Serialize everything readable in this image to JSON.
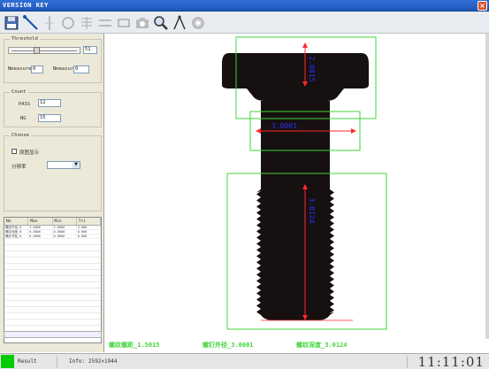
{
  "window": {
    "title": "VERSION KEY",
    "close_symbol": "×"
  },
  "toolbar": {
    "buttons": [
      "save-icon",
      "line-tool-icon",
      "vertical-line-icon",
      "circle-icon",
      "grid-icon",
      "horizontal-lines-icon",
      "rectangle-icon",
      "camera-icon",
      "zoom-icon",
      "compass-icon",
      "settings-icon"
    ]
  },
  "threshold": {
    "label": "Threshold",
    "value": "51",
    "nmeasure_label": "Nmeasure",
    "nmeasure_value": "0",
    "nmeasure2_label": "Nmeasure",
    "nmeasure2_value": "0",
    "slider_fraction": 0.38
  },
  "count": {
    "label": "Count",
    "pass_label": "PASS",
    "pass_value": "12",
    "ng_label": "NG",
    "ng_value": "15"
  },
  "choose": {
    "label": "Choose",
    "checkbox_label": "原图显示",
    "resolution_label": "分辨率",
    "resolution_value": ""
  },
  "table": {
    "columns": [
      "No",
      "Max",
      "Min",
      "Tri"
    ],
    "rows": [
      [
        "螺纹外径_0",
        "3.0000",
        "2.0000",
        "3.000"
      ],
      [
        "螺纹深度_0",
        "0.0000",
        "0.0000",
        "0.000"
      ],
      [
        "螺纹节距_0",
        "0.0000",
        "0.0000",
        "0.000"
      ]
    ]
  },
  "measurements": {
    "pitch": "螺纹螺距_1.5015",
    "outer": "螺钉外径_3.0001",
    "depth": "螺纹深度_3.0124",
    "box1_label": "2.0015",
    "box2_label": "3.0001",
    "box3_label": "3.0124"
  },
  "status": {
    "result_label": "Result",
    "info_label": "Info:",
    "info_value": "2592×1944",
    "clock": "11:11:01"
  },
  "colors": {
    "accent_green": "#3fd43a",
    "measure_red": "#ff2a2a",
    "label_blue": "#2a30ff",
    "status_ok": "#00cc00"
  }
}
